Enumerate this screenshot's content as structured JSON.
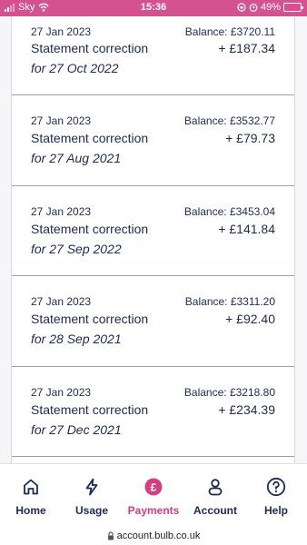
{
  "status": {
    "carrier": "Sky",
    "time": "15:36",
    "battery_text": "49%",
    "battery_level": 0.49
  },
  "transactions": [
    {
      "date": "27 Jan 2023",
      "description": "Statement correction",
      "period": "for 27 Oct 2022",
      "balance": "Balance: £3720.11",
      "amount": "+ £187.34"
    },
    {
      "date": "27 Jan 2023",
      "description": "Statement correction",
      "period": "for 27 Aug 2021",
      "balance": "Balance: £3532.77",
      "amount": "+ £79.73"
    },
    {
      "date": "27 Jan 2023",
      "description": "Statement correction",
      "period": "for 27 Sep 2022",
      "balance": "Balance: £3453.04",
      "amount": "+ £141.84"
    },
    {
      "date": "27 Jan 2023",
      "description": "Statement correction",
      "period": "for 28 Sep 2021",
      "balance": "Balance: £3311.20",
      "amount": "+ £92.40"
    },
    {
      "date": "27 Jan 2023",
      "description": "Statement correction",
      "period": "for 27 Dec 2021",
      "balance": "Balance: £3218.80",
      "amount": "+ £234.39"
    }
  ],
  "tabs": [
    {
      "label": "Home",
      "icon": "home-icon"
    },
    {
      "label": "Usage",
      "icon": "lightning-icon"
    },
    {
      "label": "Payments",
      "icon": "pound-icon",
      "active": true
    },
    {
      "label": "Account",
      "icon": "person-icon"
    },
    {
      "label": "Help",
      "icon": "help-icon"
    }
  ],
  "url": "account.bulb.co.uk",
  "colors": {
    "accent": "#d4407f",
    "status_bar": "#d4528f",
    "text": "#1c2a55"
  }
}
